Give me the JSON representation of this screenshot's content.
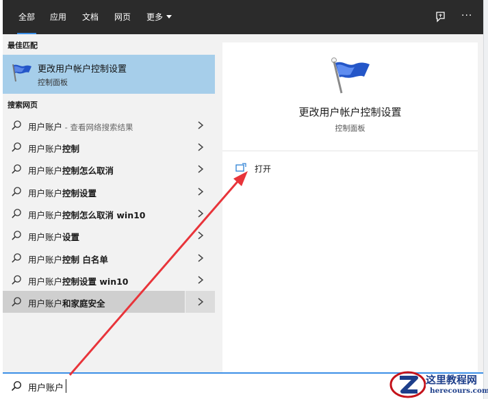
{
  "top_tabs": {
    "all": "全部",
    "apps": "应用",
    "docs": "文档",
    "web": "网页",
    "more": "更多"
  },
  "top_icons": {
    "feedback": "feedback-icon",
    "options": "more-options-icon",
    "options_glyph": "···"
  },
  "left": {
    "best_match_header": "最佳匹配",
    "best_match": {
      "title": "更改用户帐户控制设置",
      "subtitle": "控制面板",
      "icon": "uac-flag-icon"
    },
    "web_header": "搜索网页",
    "web_results": [
      {
        "text": "用户账户",
        "hint": " - 查看网络搜索结果"
      },
      {
        "text": "用户账户",
        "bold": "控制"
      },
      {
        "text": "用户账户",
        "bold": "控制怎么取消"
      },
      {
        "text": "用户账户",
        "bold": "控制设置"
      },
      {
        "text": "用户账户",
        "bold": "控制怎么取消 win10"
      },
      {
        "text": "用户账户",
        "bold": "设置"
      },
      {
        "text": "用户账户",
        "bold": "控制 白名单"
      },
      {
        "text": "用户账户",
        "bold": "控制设置 win10"
      },
      {
        "text": "用户账户",
        "bold": "和家庭安全"
      }
    ]
  },
  "detail": {
    "title": "更改用户帐户控制设置",
    "subtitle": "控制面板",
    "open_label": "打开",
    "icon": "uac-flag-icon"
  },
  "search": {
    "value": "用户账户"
  },
  "watermark": {
    "title": "这里教程网",
    "url": "herecours.com"
  },
  "colors": {
    "accent": "#3a8ee6",
    "selection": "#a6ceea",
    "annotation": "#e8343a",
    "topbar": "#2b2b2b"
  }
}
